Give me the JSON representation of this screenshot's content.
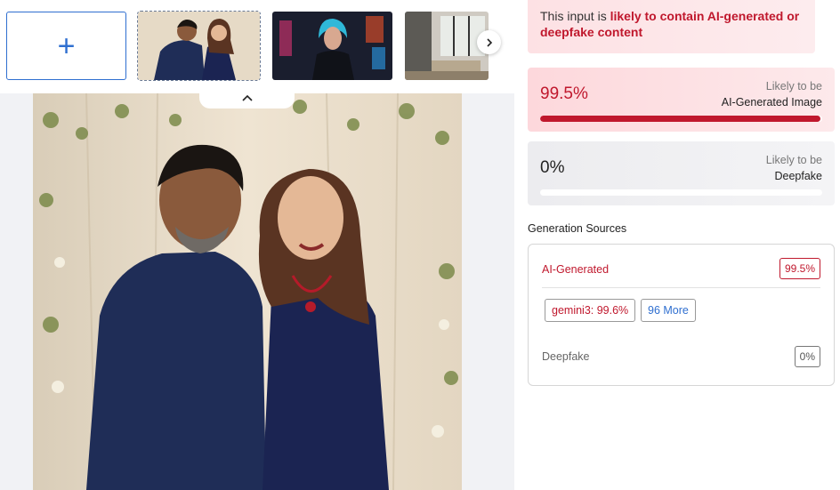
{
  "strip": {
    "add_icon": "+",
    "thumbnails": [
      {
        "name": "couple-photo",
        "selected": true
      },
      {
        "name": "cyberpunk-woman",
        "selected": false
      },
      {
        "name": "living-room",
        "selected": false
      }
    ],
    "next_icon": "chevron-right-icon",
    "collapse_icon": "chevron-up-icon"
  },
  "result": {
    "verdict_prefix": "This input is ",
    "verdict_highlight": "likely to contain AI-generated or deepfake content",
    "ai_card": {
      "percent": "99.5%",
      "likely": "Likely to be",
      "label": "AI-Generated Image",
      "level": 0.995
    },
    "deepfake_card": {
      "percent": "0%",
      "likely": "Likely to be",
      "label": "Deepfake",
      "level": 0.0
    },
    "sources_title": "Generation Sources",
    "sources": {
      "ai_label": "AI-Generated",
      "ai_badge": "99.5%",
      "model_chip": "gemini3: 99.6%",
      "more_chip": "96 More",
      "deepfake_label": "Deepfake",
      "deepfake_badge": "0%"
    }
  },
  "colors": {
    "accent": "#2f6fd0",
    "danger": "#c0182d"
  }
}
